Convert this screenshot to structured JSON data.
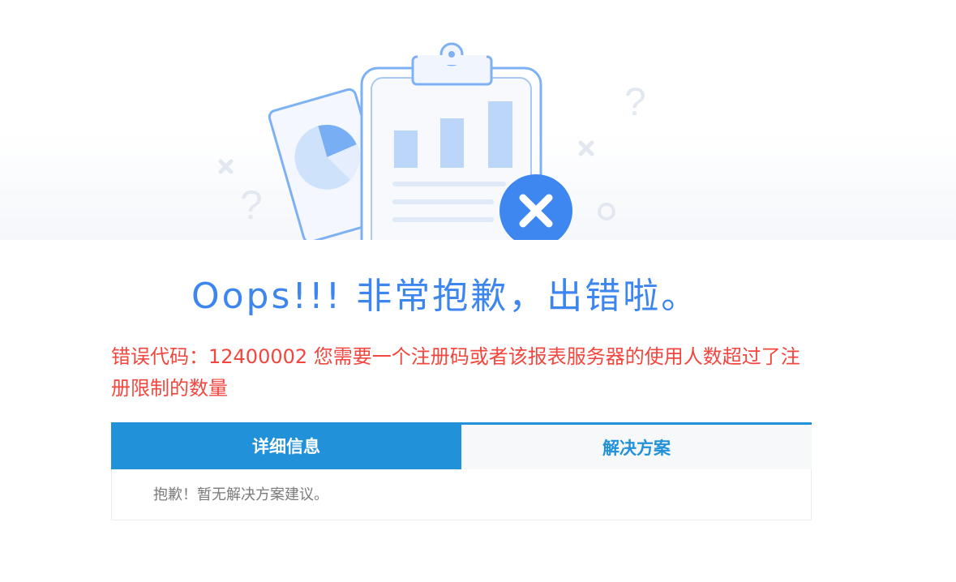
{
  "headline": "Oops!!! 非常抱歉，出错啦。",
  "error": {
    "text": "错误代码：12400002 您需要一个注册码或者该报表服务器的使用人数超过了注册限制的数量"
  },
  "tabs": [
    {
      "label": "详细信息",
      "active": true
    },
    {
      "label": "解决方案",
      "active": false
    }
  ],
  "panel": {
    "content": "抱歉！暂无解决方案建议。"
  },
  "colors": {
    "headline": "#3e86ef",
    "error": "#f2463f",
    "tab_active_bg": "#2191da",
    "tab_inactive_bg": "#f6f8fa"
  },
  "icons": [
    "clipboard-illustration",
    "pie-chart-card",
    "error-x-icon",
    "question-mark-icon",
    "cross-mark-icon",
    "circle-mark-icon"
  ]
}
